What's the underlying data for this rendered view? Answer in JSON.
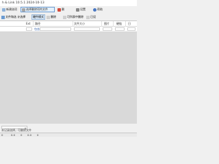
{
  "window": {
    "title": "h & Link 10.5.1 2024-10-13"
  },
  "toolbar1": {
    "buttons": [
      {
        "label": "新建选项"
      },
      {
        "label": "选择删除项符文件"
      },
      {
        "label": "删"
      },
      {
        "label": "设置"
      },
      {
        "label": "帮助"
      }
    ]
  },
  "toolbar2": {
    "left_label": "文件和选 计选择",
    "tabs": [
      "硬件模式",
      "删除",
      "可列表中删除",
      "已设"
    ]
  },
  "grid": {
    "columns": [
      "Ext",
      "路径",
      "文件大小",
      "图片",
      "硬链",
      "日"
    ],
    "filter_value": "包含"
  },
  "bottom": {
    "info_text": "本记录选择，可删除文件"
  },
  "status": {
    "segments": [
      "0",
      "0.0",
      "0",
      "0.0",
      "0"
    ]
  }
}
